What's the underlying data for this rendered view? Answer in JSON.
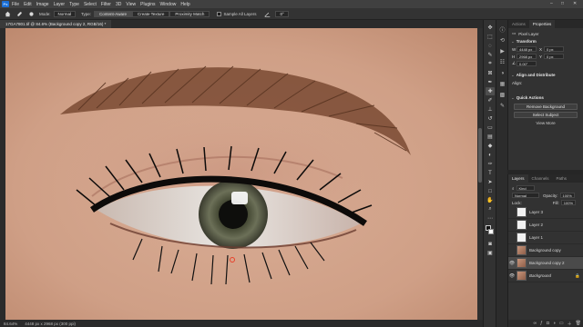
{
  "menu": [
    "File",
    "Edit",
    "Image",
    "Layer",
    "Type",
    "Select",
    "Filter",
    "3D",
    "View",
    "Plugins",
    "Window",
    "Help"
  ],
  "app_logo": "Ps",
  "window_controls": [
    "–",
    "□",
    "✕"
  ],
  "options": {
    "mode_label": "Mode:",
    "mode_value": "Normal",
    "type_label": "Type:",
    "type_options": [
      "Content-Aware",
      "Create Texture",
      "Proximity Match"
    ],
    "type_selected": "Content-Aware",
    "sample_all_layers": "Sample All Layers",
    "angle_value": "0°"
  },
  "document": {
    "tab_title": "17GA7801.tif @ 84.6% (Background copy 2, RGB/16) *",
    "zoom": "84.64%",
    "status": "4448 px x 2968 px (300 ppi)"
  },
  "colors": {
    "accent": "#1c6fd6",
    "brush_cursor": "#e8402a",
    "skin": "#d1a48c"
  },
  "tools": [
    "move-icon",
    "marquee-icon",
    "lasso-icon",
    "quick-select-icon",
    "crop-icon",
    "frame-icon",
    "eyedropper-icon",
    "spot-heal-icon",
    "brush-icon",
    "stamp-icon",
    "history-brush-icon",
    "eraser-icon",
    "gradient-icon",
    "blur-icon",
    "dodge-icon",
    "pen-icon",
    "type-icon",
    "path-select-icon",
    "rectangle-icon",
    "hand-icon",
    "zoom-icon"
  ],
  "properties": {
    "tabs": [
      "Actions",
      "Properties"
    ],
    "active_tab": "Properties",
    "layer_kind": "Pixel Layer",
    "transform_title": "Transform",
    "w_label": "W",
    "w_value": "4448 px",
    "h_label": "H",
    "h_value": "2968 px",
    "x_label": "X",
    "x_value": "0 px",
    "y_label": "Y",
    "y_value": "0 px",
    "angle_value": "0.00°",
    "align_title": "Align and Distribute",
    "align_label": "Align:",
    "quick_actions_title": "Quick Actions",
    "remove_bg": "Remove Background",
    "select_subject": "Select Subject",
    "more_link": "View More"
  },
  "layers_panel": {
    "tabs": [
      "Layers",
      "Channels",
      "Paths"
    ],
    "active_tab": "Layers",
    "kind_label": "Kind",
    "blend_mode": "Normal",
    "opacity_label": "Opacity:",
    "opacity_value": "100%",
    "lock_label": "Lock:",
    "fill_label": "Fill:",
    "fill_value": "100%",
    "layers": [
      {
        "name": "Layer 3",
        "thumb": "white",
        "visible": false,
        "selected": false,
        "italic": false
      },
      {
        "name": "Layer 2",
        "thumb": "white",
        "visible": false,
        "selected": false,
        "italic": false
      },
      {
        "name": "Layer 1",
        "thumb": "white",
        "visible": false,
        "selected": false,
        "italic": false
      },
      {
        "name": "Background copy",
        "thumb": "face",
        "visible": false,
        "selected": false,
        "italic": false
      },
      {
        "name": "Background copy 2",
        "thumb": "face",
        "visible": true,
        "selected": true,
        "italic": false
      },
      {
        "name": "Background",
        "thumb": "face",
        "visible": true,
        "selected": false,
        "italic": true
      }
    ]
  }
}
